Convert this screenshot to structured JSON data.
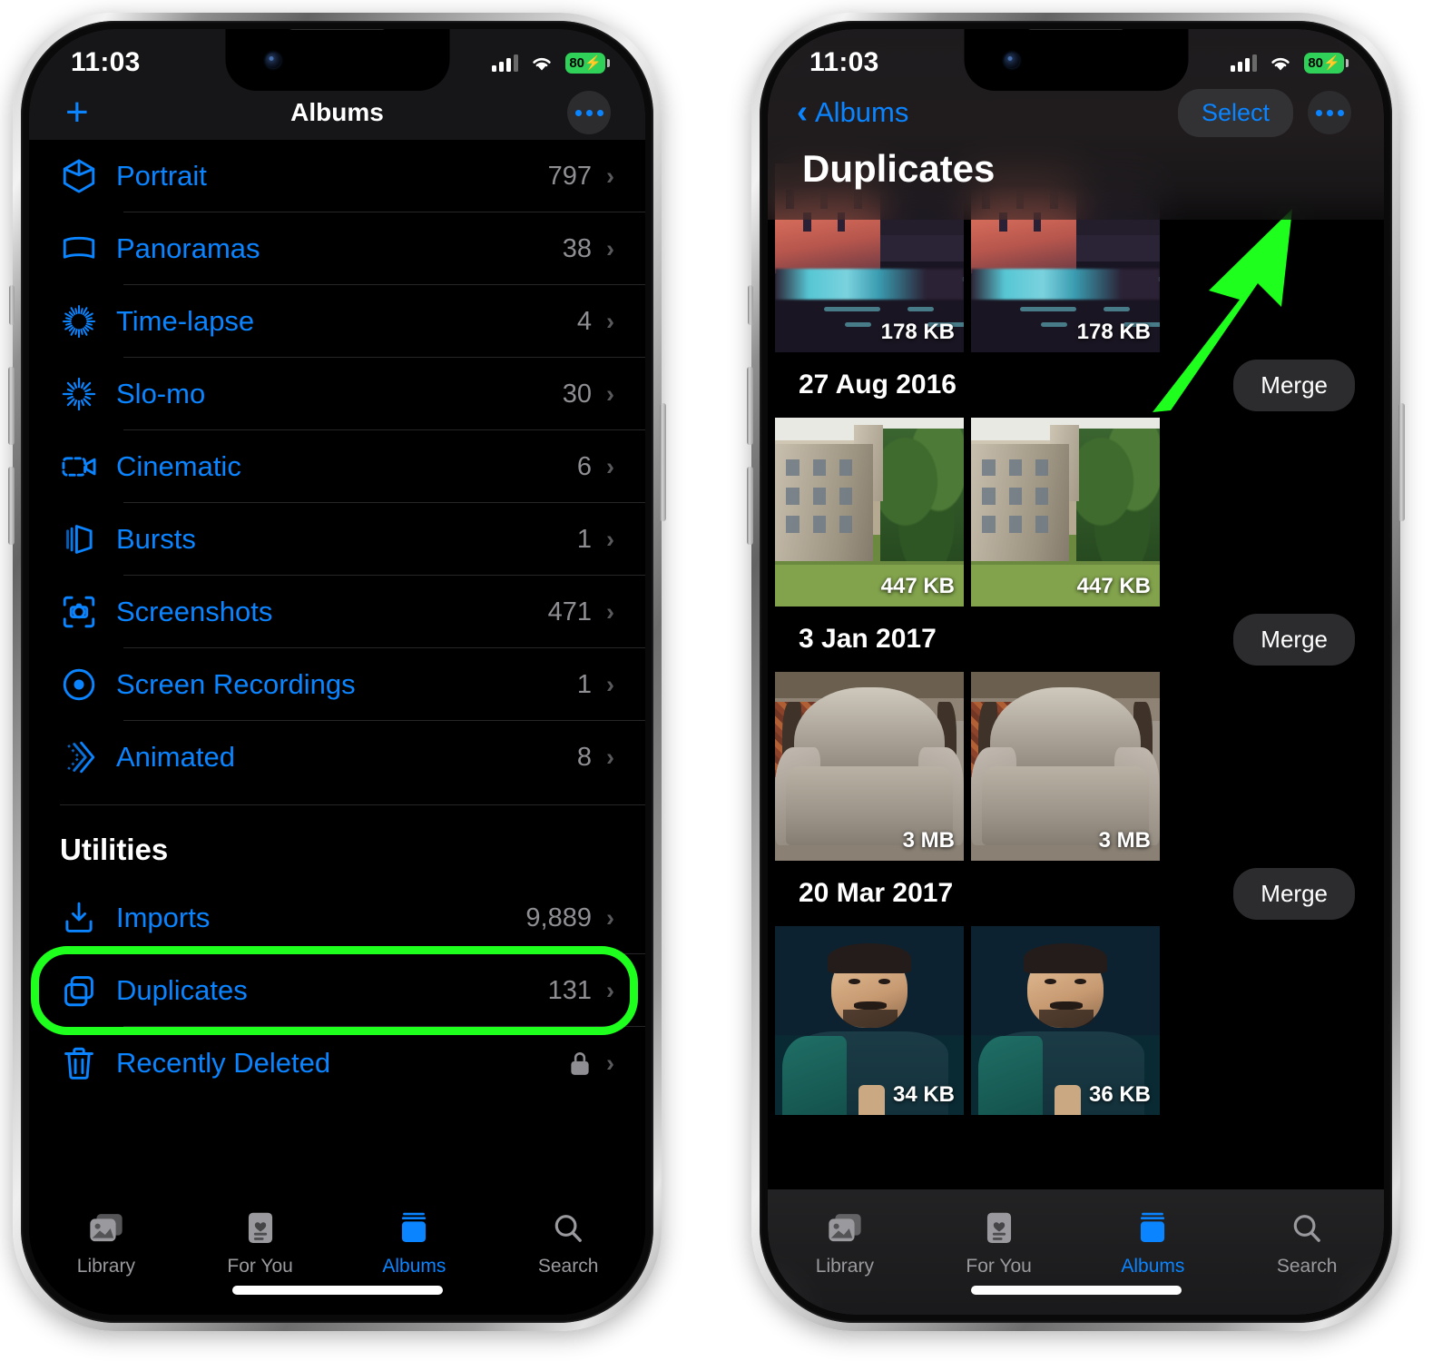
{
  "accent_blue": "#0a84ff",
  "highlight_green": "#1eff1e",
  "battery_green": "#30d158",
  "status_bar": {
    "time": "11:03",
    "battery_level": "80",
    "battery_bolt": "⚡",
    "wifi_icon": "wifi-icon",
    "cellular_icon": "cellular-signal-icon"
  },
  "left_phone": {
    "nav": {
      "add_icon": "+",
      "title": "Albums",
      "more_icon": "ellipsis-icon"
    },
    "albums": [
      {
        "icon": "portrait-cube-icon",
        "label": "Portrait",
        "count": "797"
      },
      {
        "icon": "panorama-icon",
        "label": "Panoramas",
        "count": "38"
      },
      {
        "icon": "timelapse-icon",
        "label": "Time-lapse",
        "count": "4"
      },
      {
        "icon": "slomo-icon",
        "label": "Slo-mo",
        "count": "30"
      },
      {
        "icon": "cinematic-video-icon",
        "label": "Cinematic",
        "count": "6"
      },
      {
        "icon": "bursts-icon",
        "label": "Bursts",
        "count": "1"
      },
      {
        "icon": "screenshots-icon",
        "label": "Screenshots",
        "count": "471"
      },
      {
        "icon": "screen-recordings-icon",
        "label": "Screen Recordings",
        "count": "1"
      },
      {
        "icon": "animated-icon",
        "label": "Animated",
        "count": "8"
      }
    ],
    "utilities_header": "Utilities",
    "utilities": [
      {
        "icon": "imports-icon",
        "label": "Imports",
        "count": "9,889",
        "locked": false,
        "highlighted": false
      },
      {
        "icon": "duplicates-icon",
        "label": "Duplicates",
        "count": "131",
        "locked": false,
        "highlighted": true
      },
      {
        "icon": "trash-icon",
        "label": "Recently Deleted",
        "count": "",
        "locked": true,
        "highlighted": false
      }
    ],
    "chevron": "›"
  },
  "right_phone": {
    "nav": {
      "back_icon": "chevron-left-icon",
      "back_label": "Albums",
      "select_label": "Select",
      "more_icon": "ellipsis-icon"
    },
    "large_title": "Duplicates",
    "groups": [
      {
        "date": "",
        "merge_label": "",
        "art": "canal",
        "thumbs": [
          {
            "size": "178 KB"
          },
          {
            "size": "178 KB"
          }
        ]
      },
      {
        "date": "27 Aug 2016",
        "merge_label": "Merge",
        "art": "castle",
        "thumbs": [
          {
            "size": "447 KB"
          },
          {
            "size": "447 KB"
          }
        ]
      },
      {
        "date": "3 Jan 2017",
        "merge_label": "Merge",
        "art": "chair",
        "thumbs": [
          {
            "size": "3 MB"
          },
          {
            "size": "3 MB"
          }
        ]
      },
      {
        "date": "20 Mar 2017",
        "merge_label": "Merge",
        "art": "face",
        "thumbs": [
          {
            "size": "34 KB"
          },
          {
            "size": "36 KB"
          }
        ]
      }
    ]
  },
  "tab_bar": {
    "tabs": [
      {
        "icon": "library-icon",
        "label": "Library",
        "active": false
      },
      {
        "icon": "for-you-icon",
        "label": "For You",
        "active": false
      },
      {
        "icon": "albums-icon",
        "label": "Albums",
        "active": true
      },
      {
        "icon": "search-icon",
        "label": "Search",
        "active": false
      }
    ]
  },
  "annotations": {
    "duplicates_row_highlight": "green-rounded-rectangle",
    "merge_pointer": "green-arrow"
  }
}
